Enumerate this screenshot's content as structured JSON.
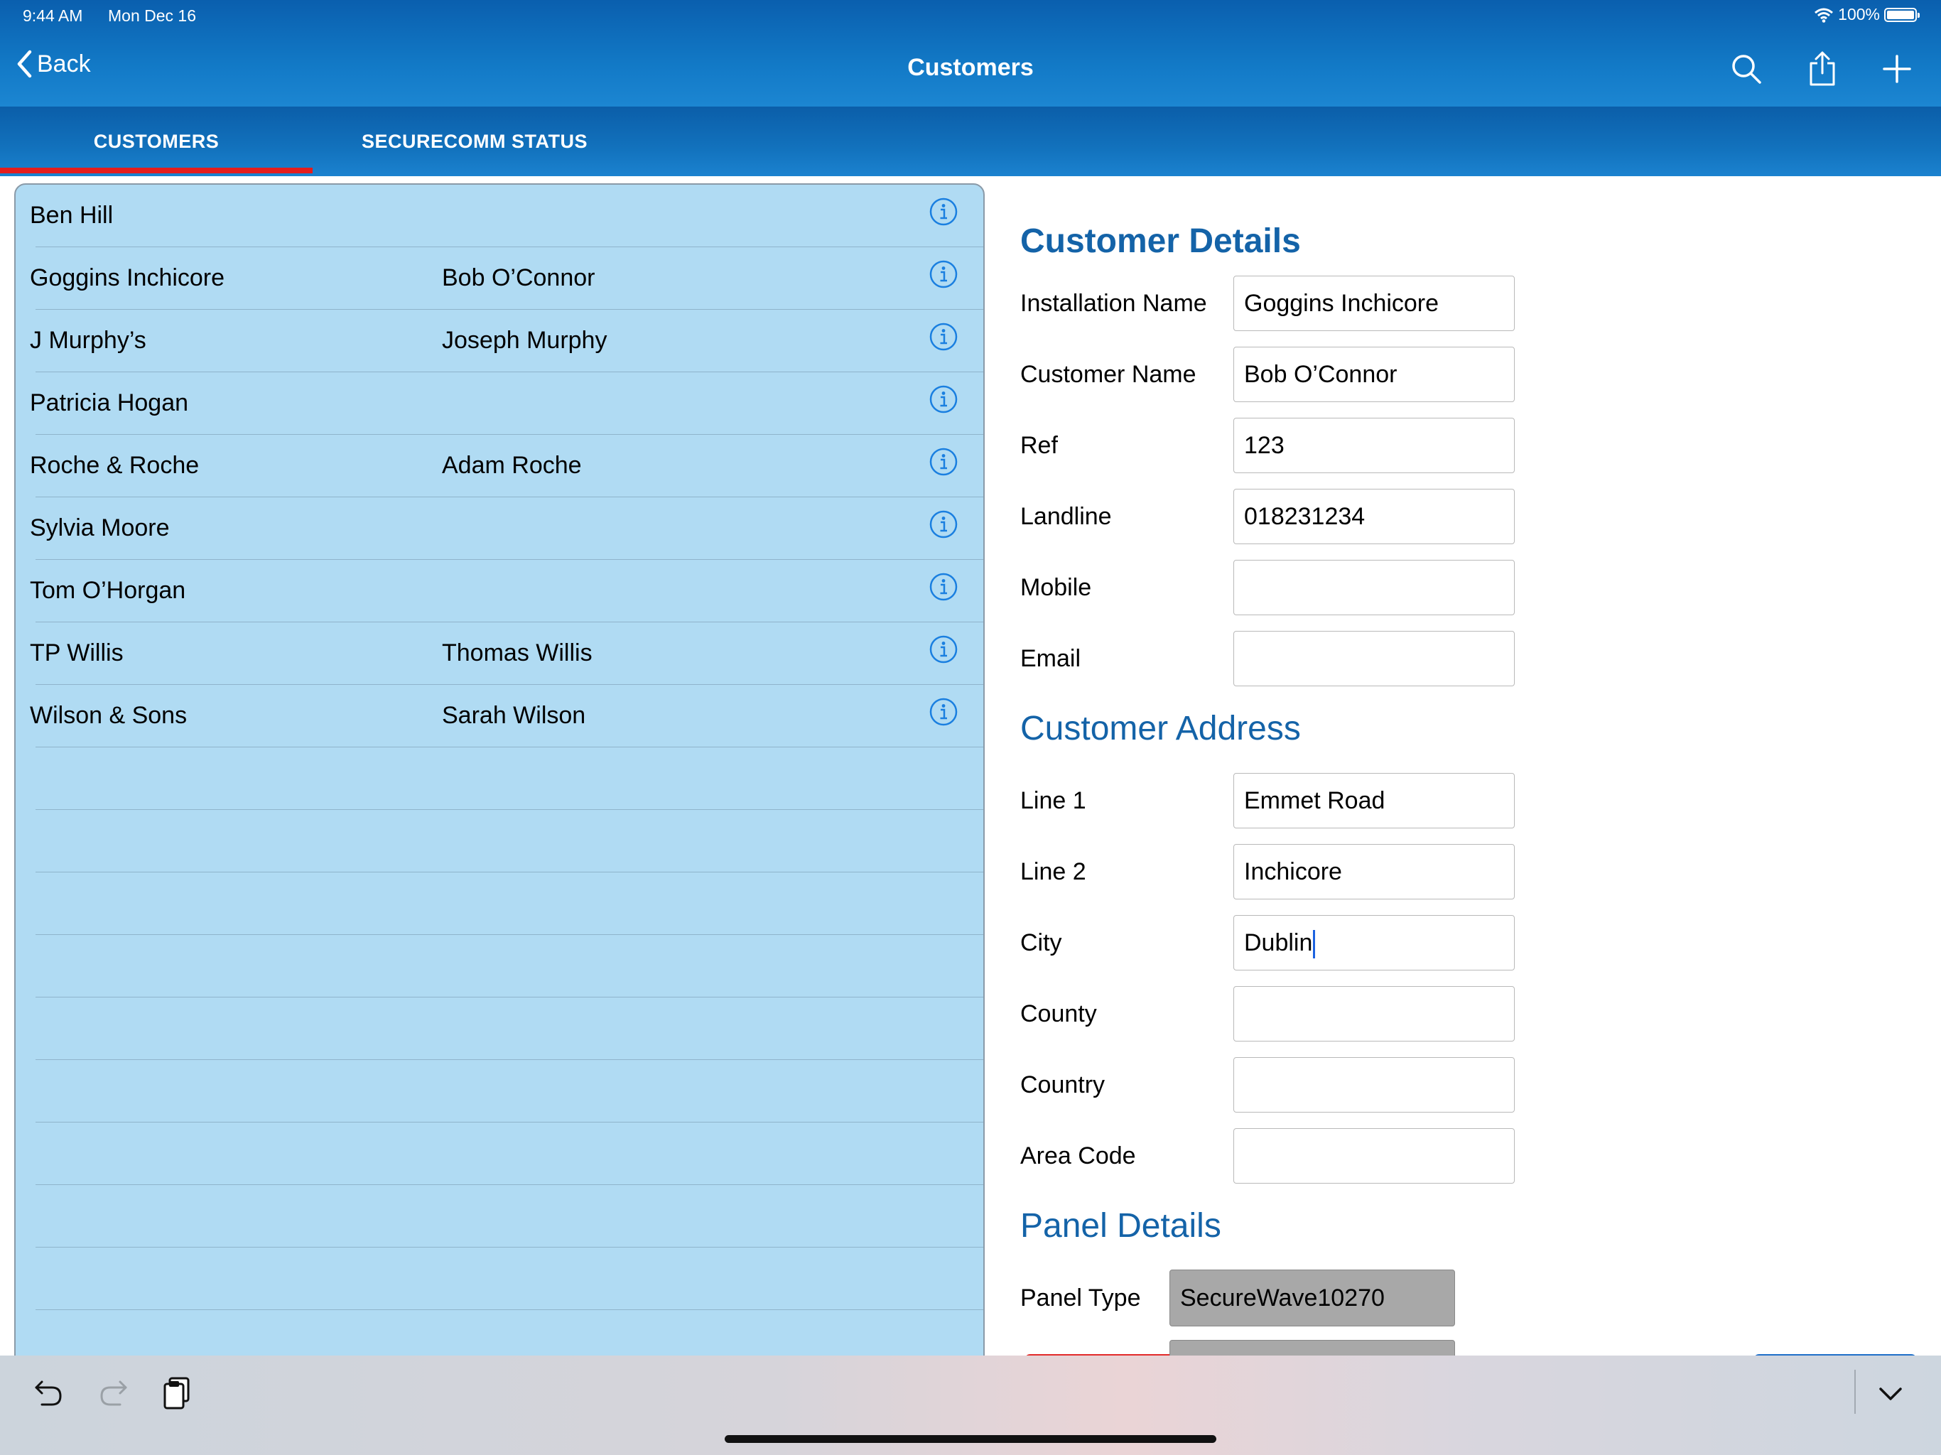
{
  "status_bar": {
    "time": "9:44 AM",
    "date": "Mon Dec 16",
    "battery": "100%"
  },
  "nav": {
    "back_label": "Back",
    "title": "Customers",
    "icons": [
      "search-icon",
      "share-icon",
      "add-icon"
    ]
  },
  "tabs": [
    {
      "label": "CUSTOMERS",
      "selected": true
    },
    {
      "label": "SECURECOMM STATUS",
      "selected": false
    }
  ],
  "customers": [
    {
      "name": "Ben Hill",
      "contact": ""
    },
    {
      "name": "Goggins Inchicore",
      "contact": "Bob O’Connor"
    },
    {
      "name": "J Murphy’s",
      "contact": "Joseph Murphy"
    },
    {
      "name": "Patricia Hogan",
      "contact": ""
    },
    {
      "name": "Roche & Roche",
      "contact": "Adam Roche"
    },
    {
      "name": "Sylvia Moore",
      "contact": ""
    },
    {
      "name": "Tom O’Horgan",
      "contact": ""
    },
    {
      "name": "TP Willis",
      "contact": "Thomas Willis"
    },
    {
      "name": "Wilson & Sons",
      "contact": "Sarah Wilson"
    }
  ],
  "customer_details": {
    "title": "Customer Details",
    "fields": [
      {
        "label": "Installation Name",
        "value": "Goggins Inchicore"
      },
      {
        "label": "Customer Name",
        "value": "Bob O’Connor"
      },
      {
        "label": "Ref",
        "value": "123"
      },
      {
        "label": "Landline",
        "value": "018231234"
      },
      {
        "label": "Mobile",
        "value": ""
      },
      {
        "label": "Email",
        "value": ""
      }
    ]
  },
  "customer_address": {
    "title": "Customer Address",
    "fields": [
      {
        "label": "Line 1",
        "value": "Emmet Road"
      },
      {
        "label": "Line 2",
        "value": "Inchicore"
      },
      {
        "label": "City",
        "value": "Dublin"
      },
      {
        "label": "County",
        "value": ""
      },
      {
        "label": "Country",
        "value": ""
      },
      {
        "label": "Area Code",
        "value": ""
      }
    ]
  },
  "panel_details": {
    "title": "Panel Details",
    "panel_type_label": "Panel Type",
    "panel_type_value": "SecureWave10270"
  },
  "colors": {
    "nav_blue": "#1279c6",
    "tab_indicator": "#e51d1d",
    "list_background": "#b0dbf3",
    "section_title": "#1463a8",
    "info_icon": "#1a7fe0"
  }
}
